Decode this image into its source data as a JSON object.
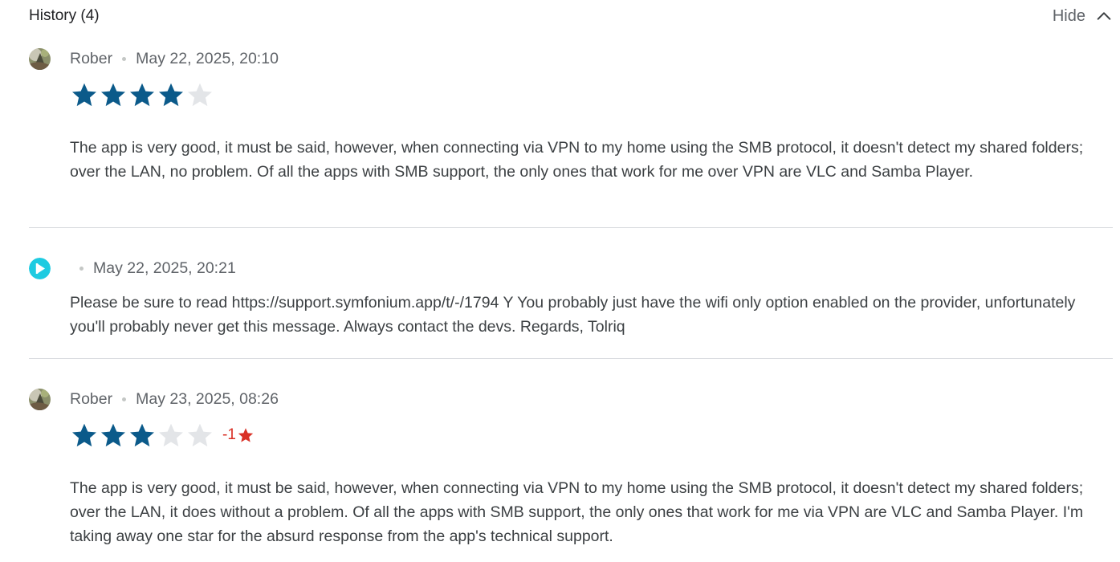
{
  "header": {
    "title": "History (4)",
    "hide_label": "Hide"
  },
  "entries": [
    {
      "author": "Rober",
      "date": "May 22, 2025, 20:10",
      "rating": 4,
      "max_rating": 5,
      "text": "The app is very good, it must be said, however, when connecting via VPN to my home using the SMB protocol, it doesn't detect my shared folders; over the LAN, no problem. Of all the apps with SMB support, the only ones that work for me over VPN are VLC and Samba Player."
    },
    {
      "author": "",
      "date": "May 22, 2025, 20:21",
      "text": "Please be sure to read https://support.symfonium.app/t/-/1794 Y You probably just have the wifi only option enabled on the provider, unfortunately you'll probably never get this message. Always contact the devs. Regards, Tolriq"
    },
    {
      "author": "Rober",
      "date": "May 23, 2025, 08:26",
      "rating": 3,
      "max_rating": 5,
      "rating_change": "-1",
      "text": "The app is very good, it must be said, however, when connecting via VPN to my home using the SMB protocol, it doesn't detect my shared folders; over the LAN, it does without a problem. Of all the apps with SMB support, the only ones that work for me via VPN are VLC and Samba Player. I'm taking away one star for the absurd response from the app's technical support."
    }
  ],
  "colors": {
    "star_filled": "#0b5a8a",
    "star_empty": "#e3e5e8",
    "rating_change": "#d93025",
    "developer_avatar": "#1ecbe1"
  },
  "icons": {
    "hide": "chevron-up-icon",
    "star": "star-icon",
    "developer_avatar": "play-logo-icon"
  }
}
